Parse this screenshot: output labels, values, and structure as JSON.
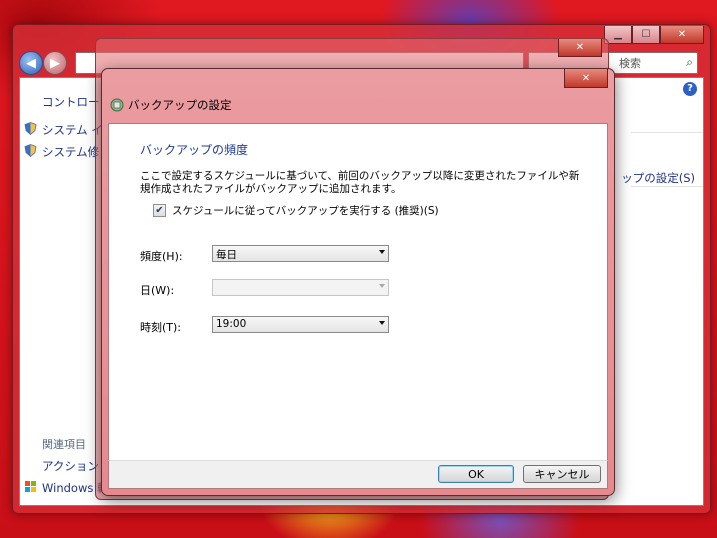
{
  "background_window": {
    "search_placeholder": "検索",
    "sidebar": {
      "home_link": "コントロー",
      "items": [
        "システム イ",
        "システム修"
      ],
      "related_header": "関連項目",
      "related_items": [
        "アクション",
        "Windows 転"
      ]
    },
    "right_link": "ップの設定(S)",
    "help_label": "?"
  },
  "dialog": {
    "title": "バックアップの設定",
    "section_heading": "バックアップの頻度",
    "description": "ここで設定するスケジュールに基づいて、前回のバックアップ以降に変更されたファイルや新規作成されたファイルがバックアップに追加されます。",
    "schedule_checkbox": {
      "label": "スケジュールに従ってバックアップを実行する (推奨)(S)",
      "checked": true
    },
    "fields": {
      "frequency": {
        "label": "頻度(H):",
        "value": "毎日"
      },
      "day": {
        "label": "日(W):",
        "value": "",
        "disabled": true
      },
      "time": {
        "label": "時刻(T):",
        "value": "19:00"
      }
    },
    "buttons": {
      "ok": "OK",
      "cancel": "キャンセル"
    }
  },
  "colors": {
    "desktop": "#d8141c",
    "dialog_frame": "#e6898e",
    "heading": "#1e3a9a",
    "link": "#1e3287"
  },
  "icons": [
    "back-arrow-icon",
    "forward-arrow-icon",
    "search-icon",
    "shield-icon",
    "backup-icon",
    "close-icon",
    "minimize-icon",
    "maximize-icon",
    "help-icon",
    "dropdown-arrow-icon",
    "checkmark-icon"
  ]
}
